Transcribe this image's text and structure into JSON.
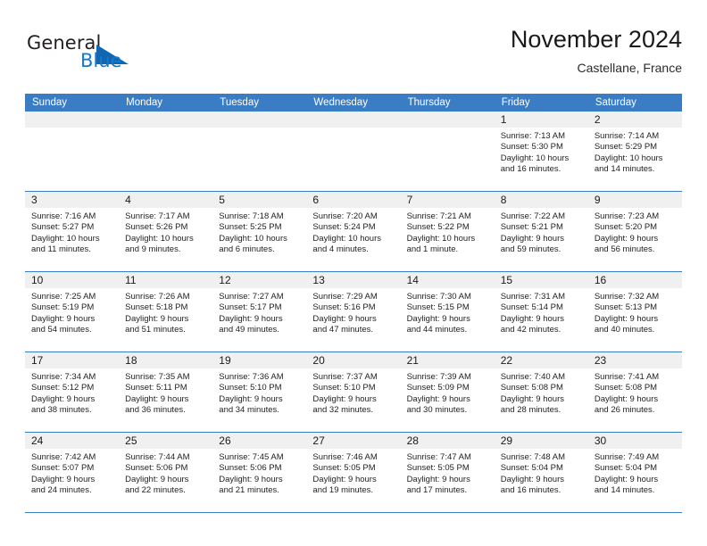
{
  "brand": {
    "name_part1": "General",
    "name_part2": "Blue",
    "logo_icon": "triangle-logo-icon",
    "accent_color": "#1166b3"
  },
  "header": {
    "title": "November 2024",
    "location": "Castellane, France"
  },
  "theme": {
    "header_blue": "#3b7dc4",
    "date_band_gray": "#f0f0f0",
    "text_color": "#1a1a1a"
  },
  "weekdays": [
    "Sunday",
    "Monday",
    "Tuesday",
    "Wednesday",
    "Thursday",
    "Friday",
    "Saturday"
  ],
  "weeks": [
    [
      {
        "day": "",
        "empty": true
      },
      {
        "day": "",
        "empty": true
      },
      {
        "day": "",
        "empty": true
      },
      {
        "day": "",
        "empty": true
      },
      {
        "day": "",
        "empty": true
      },
      {
        "day": "1",
        "sunrise": "Sunrise: 7:13 AM",
        "sunset": "Sunset: 5:30 PM",
        "daylight1": "Daylight: 10 hours",
        "daylight2": "and 16 minutes."
      },
      {
        "day": "2",
        "sunrise": "Sunrise: 7:14 AM",
        "sunset": "Sunset: 5:29 PM",
        "daylight1": "Daylight: 10 hours",
        "daylight2": "and 14 minutes."
      }
    ],
    [
      {
        "day": "3",
        "sunrise": "Sunrise: 7:16 AM",
        "sunset": "Sunset: 5:27 PM",
        "daylight1": "Daylight: 10 hours",
        "daylight2": "and 11 minutes."
      },
      {
        "day": "4",
        "sunrise": "Sunrise: 7:17 AM",
        "sunset": "Sunset: 5:26 PM",
        "daylight1": "Daylight: 10 hours",
        "daylight2": "and 9 minutes."
      },
      {
        "day": "5",
        "sunrise": "Sunrise: 7:18 AM",
        "sunset": "Sunset: 5:25 PM",
        "daylight1": "Daylight: 10 hours",
        "daylight2": "and 6 minutes."
      },
      {
        "day": "6",
        "sunrise": "Sunrise: 7:20 AM",
        "sunset": "Sunset: 5:24 PM",
        "daylight1": "Daylight: 10 hours",
        "daylight2": "and 4 minutes."
      },
      {
        "day": "7",
        "sunrise": "Sunrise: 7:21 AM",
        "sunset": "Sunset: 5:22 PM",
        "daylight1": "Daylight: 10 hours",
        "daylight2": "and 1 minute."
      },
      {
        "day": "8",
        "sunrise": "Sunrise: 7:22 AM",
        "sunset": "Sunset: 5:21 PM",
        "daylight1": "Daylight: 9 hours",
        "daylight2": "and 59 minutes."
      },
      {
        "day": "9",
        "sunrise": "Sunrise: 7:23 AM",
        "sunset": "Sunset: 5:20 PM",
        "daylight1": "Daylight: 9 hours",
        "daylight2": "and 56 minutes."
      }
    ],
    [
      {
        "day": "10",
        "sunrise": "Sunrise: 7:25 AM",
        "sunset": "Sunset: 5:19 PM",
        "daylight1": "Daylight: 9 hours",
        "daylight2": "and 54 minutes."
      },
      {
        "day": "11",
        "sunrise": "Sunrise: 7:26 AM",
        "sunset": "Sunset: 5:18 PM",
        "daylight1": "Daylight: 9 hours",
        "daylight2": "and 51 minutes."
      },
      {
        "day": "12",
        "sunrise": "Sunrise: 7:27 AM",
        "sunset": "Sunset: 5:17 PM",
        "daylight1": "Daylight: 9 hours",
        "daylight2": "and 49 minutes."
      },
      {
        "day": "13",
        "sunrise": "Sunrise: 7:29 AM",
        "sunset": "Sunset: 5:16 PM",
        "daylight1": "Daylight: 9 hours",
        "daylight2": "and 47 minutes."
      },
      {
        "day": "14",
        "sunrise": "Sunrise: 7:30 AM",
        "sunset": "Sunset: 5:15 PM",
        "daylight1": "Daylight: 9 hours",
        "daylight2": "and 44 minutes."
      },
      {
        "day": "15",
        "sunrise": "Sunrise: 7:31 AM",
        "sunset": "Sunset: 5:14 PM",
        "daylight1": "Daylight: 9 hours",
        "daylight2": "and 42 minutes."
      },
      {
        "day": "16",
        "sunrise": "Sunrise: 7:32 AM",
        "sunset": "Sunset: 5:13 PM",
        "daylight1": "Daylight: 9 hours",
        "daylight2": "and 40 minutes."
      }
    ],
    [
      {
        "day": "17",
        "sunrise": "Sunrise: 7:34 AM",
        "sunset": "Sunset: 5:12 PM",
        "daylight1": "Daylight: 9 hours",
        "daylight2": "and 38 minutes."
      },
      {
        "day": "18",
        "sunrise": "Sunrise: 7:35 AM",
        "sunset": "Sunset: 5:11 PM",
        "daylight1": "Daylight: 9 hours",
        "daylight2": "and 36 minutes."
      },
      {
        "day": "19",
        "sunrise": "Sunrise: 7:36 AM",
        "sunset": "Sunset: 5:10 PM",
        "daylight1": "Daylight: 9 hours",
        "daylight2": "and 34 minutes."
      },
      {
        "day": "20",
        "sunrise": "Sunrise: 7:37 AM",
        "sunset": "Sunset: 5:10 PM",
        "daylight1": "Daylight: 9 hours",
        "daylight2": "and 32 minutes."
      },
      {
        "day": "21",
        "sunrise": "Sunrise: 7:39 AM",
        "sunset": "Sunset: 5:09 PM",
        "daylight1": "Daylight: 9 hours",
        "daylight2": "and 30 minutes."
      },
      {
        "day": "22",
        "sunrise": "Sunrise: 7:40 AM",
        "sunset": "Sunset: 5:08 PM",
        "daylight1": "Daylight: 9 hours",
        "daylight2": "and 28 minutes."
      },
      {
        "day": "23",
        "sunrise": "Sunrise: 7:41 AM",
        "sunset": "Sunset: 5:08 PM",
        "daylight1": "Daylight: 9 hours",
        "daylight2": "and 26 minutes."
      }
    ],
    [
      {
        "day": "24",
        "sunrise": "Sunrise: 7:42 AM",
        "sunset": "Sunset: 5:07 PM",
        "daylight1": "Daylight: 9 hours",
        "daylight2": "and 24 minutes."
      },
      {
        "day": "25",
        "sunrise": "Sunrise: 7:44 AM",
        "sunset": "Sunset: 5:06 PM",
        "daylight1": "Daylight: 9 hours",
        "daylight2": "and 22 minutes."
      },
      {
        "day": "26",
        "sunrise": "Sunrise: 7:45 AM",
        "sunset": "Sunset: 5:06 PM",
        "daylight1": "Daylight: 9 hours",
        "daylight2": "and 21 minutes."
      },
      {
        "day": "27",
        "sunrise": "Sunrise: 7:46 AM",
        "sunset": "Sunset: 5:05 PM",
        "daylight1": "Daylight: 9 hours",
        "daylight2": "and 19 minutes."
      },
      {
        "day": "28",
        "sunrise": "Sunrise: 7:47 AM",
        "sunset": "Sunset: 5:05 PM",
        "daylight1": "Daylight: 9 hours",
        "daylight2": "and 17 minutes."
      },
      {
        "day": "29",
        "sunrise": "Sunrise: 7:48 AM",
        "sunset": "Sunset: 5:04 PM",
        "daylight1": "Daylight: 9 hours",
        "daylight2": "and 16 minutes."
      },
      {
        "day": "30",
        "sunrise": "Sunrise: 7:49 AM",
        "sunset": "Sunset: 5:04 PM",
        "daylight1": "Daylight: 9 hours",
        "daylight2": "and 14 minutes."
      }
    ]
  ]
}
